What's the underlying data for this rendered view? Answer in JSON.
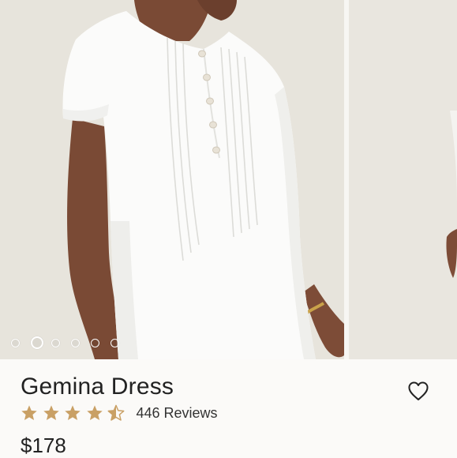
{
  "product": {
    "name": "Gemina Dress",
    "reviews_label": "446 Reviews",
    "price": "$178",
    "rating": 4.5,
    "rating_max": 5
  },
  "gallery": {
    "slide_count": 6,
    "active_index": 1,
    "main_image": "woman in white short-sleeve pintucked linen dress",
    "next_image": "white dress, second view"
  },
  "icons": {
    "wishlist": "heart-outline-icon",
    "star": "star-icon"
  },
  "colors": {
    "star_fill": "#c9a065",
    "text": "#222222",
    "background": "#fbfaf8"
  }
}
